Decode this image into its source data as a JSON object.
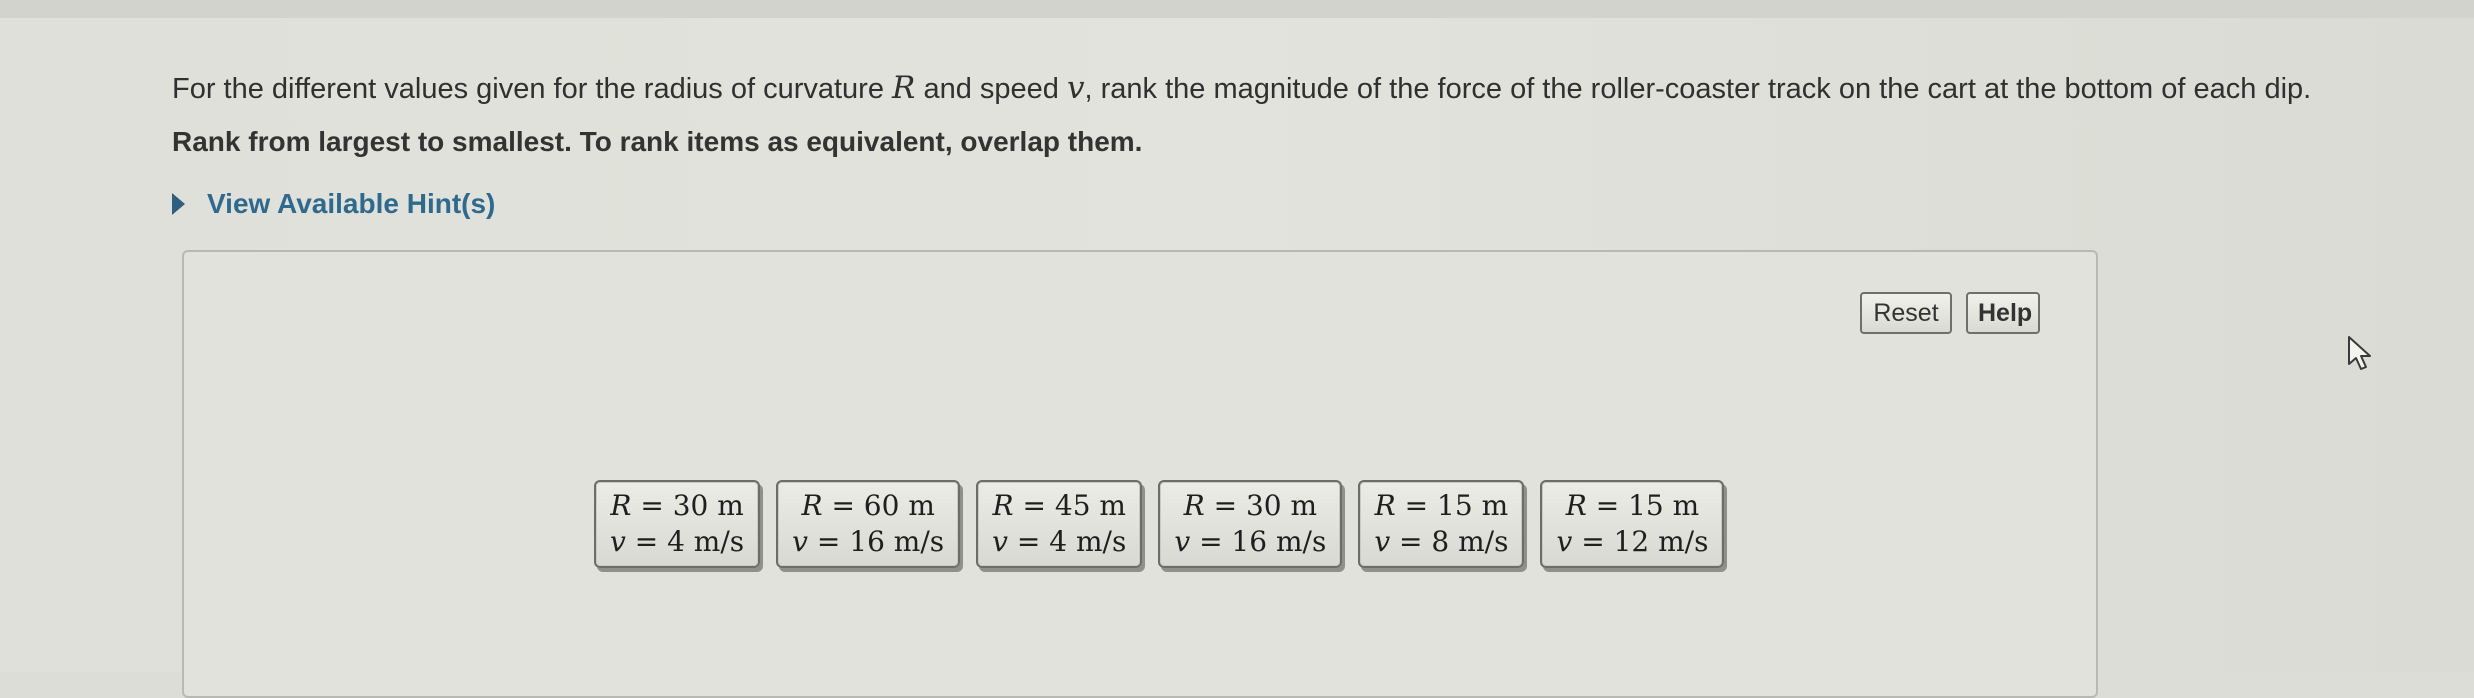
{
  "question": {
    "prefix": "For the different values given for the radius of curvature",
    "var_r": "R",
    "middle": "and speed",
    "var_v": "v",
    "suffix": ", rank the magnitude of the force of the roller-coaster track on the cart at the bottom of each dip."
  },
  "instruction": "Rank from largest to smallest. To rank items as equivalent, overlap them.",
  "hint_label": "View Available Hint(s)",
  "buttons": {
    "reset": "Reset",
    "help": "Help"
  },
  "items": [
    {
      "r_sym": "R",
      "r_val": "= 30 m",
      "v_sym": "v",
      "v_val": "= 4 m/s"
    },
    {
      "r_sym": "R",
      "r_val": "= 60 m",
      "v_sym": "v",
      "v_val": "= 16 m/s"
    },
    {
      "r_sym": "R",
      "r_val": "= 45 m",
      "v_sym": "v",
      "v_val": "= 4 m/s"
    },
    {
      "r_sym": "R",
      "r_val": "= 30 m",
      "v_sym": "v",
      "v_val": "= 16 m/s"
    },
    {
      "r_sym": "R",
      "r_val": "= 15 m",
      "v_sym": "v",
      "v_val": "= 8 m/s"
    },
    {
      "r_sym": "R",
      "r_val": "= 15 m",
      "v_sym": "v",
      "v_val": "= 12 m/s"
    }
  ],
  "colors": {
    "hint_accent": "#2f6a8e",
    "background": "#dcddd6"
  },
  "icons": {
    "hint_toggle": "triangle-right-icon",
    "cursor": "mouse-pointer-icon"
  }
}
